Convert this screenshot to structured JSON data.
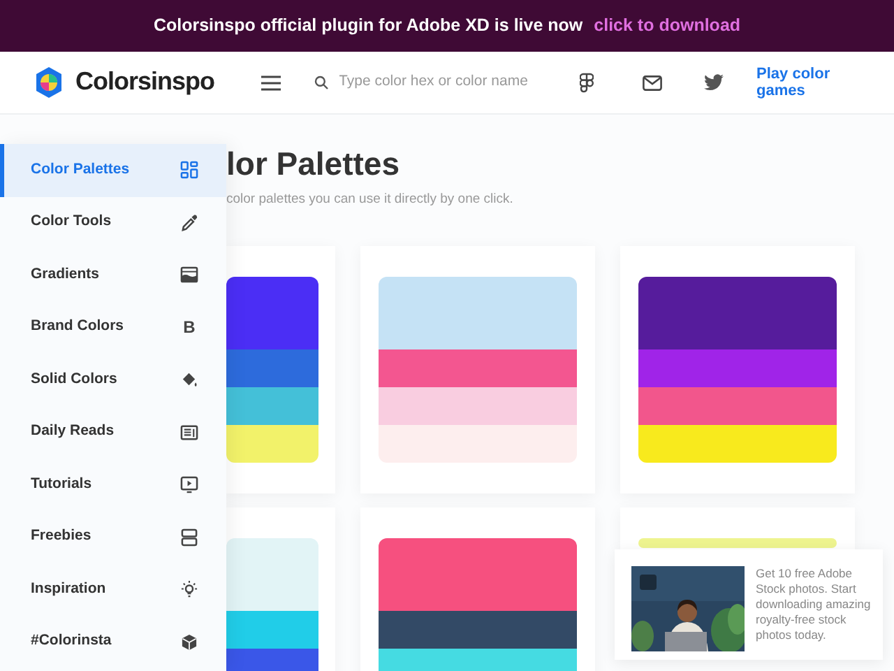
{
  "banner": {
    "text": "Colorsinspo official plugin for Adobe XD is live now",
    "link": "click to download"
  },
  "header": {
    "logo": "Colorsinspo",
    "search": {
      "placeholder": "Type color hex or color name"
    },
    "play_link": "Play color games"
  },
  "sidebar": {
    "items": [
      {
        "label": "Color Palettes",
        "selected": true
      },
      {
        "label": "Color Tools",
        "selected": false
      },
      {
        "label": "Gradients",
        "selected": false
      },
      {
        "label": "Brand Colors",
        "selected": false,
        "glyph": "B"
      },
      {
        "label": "Solid Colors",
        "selected": false
      },
      {
        "label": "Daily Reads",
        "selected": false
      },
      {
        "label": "Tutorials",
        "selected": false
      },
      {
        "label": "Freebies",
        "selected": false
      },
      {
        "label": "Inspiration",
        "selected": false
      },
      {
        "label": "#Colorinsta",
        "selected": false
      }
    ]
  },
  "main": {
    "heading": "lor Palettes",
    "subtitle": "color palettes you can use it directly by one click.",
    "palettes": [
      {
        "swatches": [
          {
            "color": "#4b2ef5"
          },
          {
            "color": "#2d6bdc"
          },
          {
            "color": "#44c0d8"
          },
          {
            "color": "#f2f26a"
          }
        ]
      },
      {
        "swatches": [
          {
            "color": "#c5e2f5"
          },
          {
            "color": "#f35690"
          },
          {
            "color": "#f9cde0"
          },
          {
            "color": "#fdeeee"
          }
        ]
      },
      {
        "swatches": [
          {
            "color": "#561c9c"
          },
          {
            "color": "#a024e8"
          },
          {
            "color": "#f2568c"
          },
          {
            "color": "#f8ea1d"
          }
        ]
      },
      {
        "swatches": [
          {
            "color": "#e2f4f6"
          },
          {
            "color": "#21cde8"
          },
          {
            "color": "#3a57e8"
          }
        ]
      },
      {
        "swatches": [
          {
            "color": "#f6507f"
          },
          {
            "color": "#334a66"
          },
          {
            "color": "#45dbe2"
          }
        ]
      },
      {
        "swatches": [
          {
            "color": "#eef48f"
          }
        ]
      }
    ]
  },
  "ad": {
    "kind": "picture",
    "text": "Get 10 free Adobe Stock photos. Start downloading amazing royalty-free stock photos today."
  }
}
